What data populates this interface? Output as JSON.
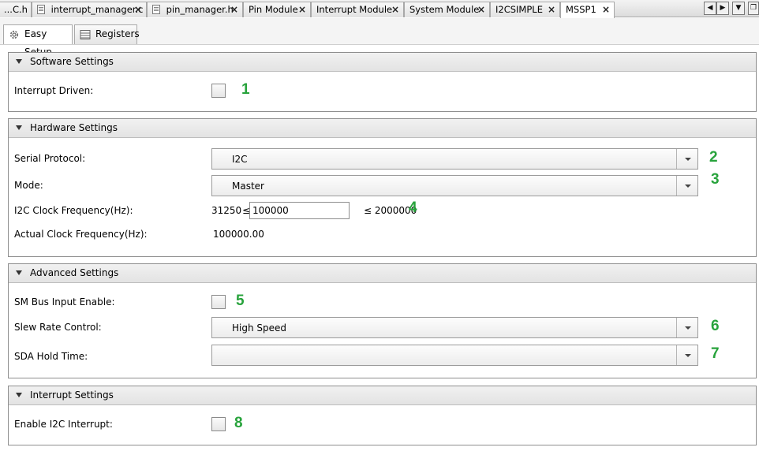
{
  "tabs": [
    {
      "label": "...C.h",
      "icon": "",
      "close": "",
      "active": false
    },
    {
      "label": "interrupt_manager.c",
      "icon": "source-file-icon",
      "close": "×",
      "active": false
    },
    {
      "label": "pin_manager.h",
      "icon": "source-file-icon",
      "close": "×",
      "active": false
    },
    {
      "label": "Pin Module",
      "icon": "",
      "close": "×",
      "active": false
    },
    {
      "label": "Interrupt Module",
      "icon": "",
      "close": "×",
      "active": false
    },
    {
      "label": "System Module",
      "icon": "",
      "close": "×",
      "active": false
    },
    {
      "label": "I2CSIMPLE",
      "icon": "",
      "close": "×",
      "active": false
    },
    {
      "label": "MSSP1",
      "icon": "",
      "close": "×",
      "active": true
    }
  ],
  "tab_nav": {
    "left": "◀",
    "right": "▶",
    "menu": "▼",
    "restore": "❐"
  },
  "subtabs": [
    {
      "label": "Easy Setup",
      "icon": "gear-icon",
      "active": true
    },
    {
      "label": "Registers",
      "icon": "register-table-icon",
      "active": false
    }
  ],
  "software": {
    "title": "Software Settings",
    "interrupt_driven_label": "Interrupt Driven:",
    "interrupt_driven_checked": false,
    "marker": "1"
  },
  "hardware": {
    "title": "Hardware Settings",
    "serial_protocol_label": "Serial Protocol:",
    "serial_protocol_value": "I2C",
    "serial_protocol_marker": "2",
    "mode_label": "Mode:",
    "mode_value": "Master",
    "mode_marker": "3",
    "clock_label": "I2C Clock Frequency(Hz):",
    "clock_min": "31250",
    "leq": "≤",
    "clock_value": "100000",
    "clock_max": "≤ 2000000",
    "clock_marker": "4",
    "actual_label": "Actual Clock Frequency(Hz):",
    "actual_value": "100000.00"
  },
  "advanced": {
    "title": "Advanced Settings",
    "smbus_label": "SM Bus Input Enable:",
    "smbus_checked": false,
    "smbus_marker": "5",
    "slew_label": "Slew Rate Control:",
    "slew_value": "High Speed",
    "slew_marker": "6",
    "sda_label": "SDA Hold Time:",
    "sda_value": "",
    "sda_marker": "7"
  },
  "interrupt": {
    "title": "Interrupt Settings",
    "enable_label": "Enable I2C Interrupt:",
    "enable_checked": false,
    "marker": "8"
  },
  "colors": {
    "marker": "#28a33c",
    "border": "#8e8e8e",
    "header_bg": "#e8e8e8"
  }
}
